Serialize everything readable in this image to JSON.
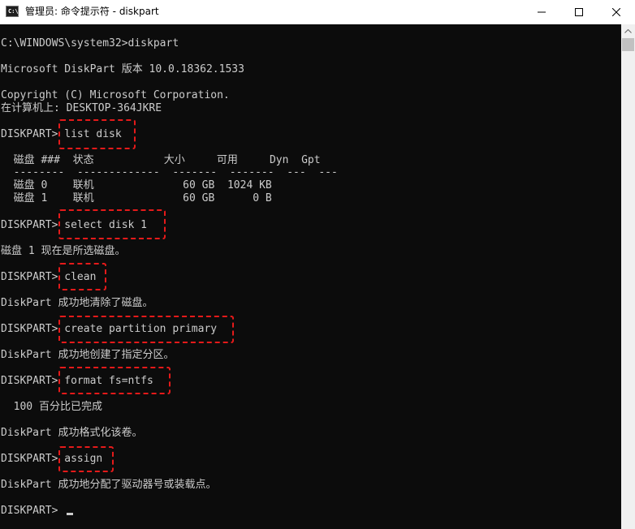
{
  "window": {
    "title": "管理员: 命令提示符 - diskpart",
    "icon_text": "C:\\"
  },
  "console": {
    "lines": [
      "C:\\WINDOWS\\system32>diskpart",
      "Microsoft DiskPart 版本 10.0.18362.1533",
      "Copyright (C) Microsoft Corporation.",
      "在计算机上: DESKTOP-364JKRE",
      "DISKPART> list disk",
      "  磁盘 ###  状态           大小     可用     Dyn  Gpt",
      "  --------  -------------  -------  -------  ---  ---",
      "  磁盘 0    联机              60 GB  1024 KB",
      "  磁盘 1    联机              60 GB      0 B",
      "DISKPART> select disk 1",
      "磁盘 1 现在是所选磁盘。",
      "DISKPART> clean",
      "DiskPart 成功地清除了磁盘。",
      "DISKPART> create partition primary",
      "DiskPart 成功地创建了指定分区。",
      "DISKPART> format fs=ntfs",
      "  100 百分比已完成",
      "DiskPart 成功格式化该卷。",
      "DISKPART> assign",
      "DiskPart 成功地分配了驱动器号或装载点。",
      "DISKPART> "
    ]
  },
  "colors": {
    "console_bg": "#0c0c0c",
    "console_text": "#cccccc",
    "highlight": "#e51a1a"
  }
}
